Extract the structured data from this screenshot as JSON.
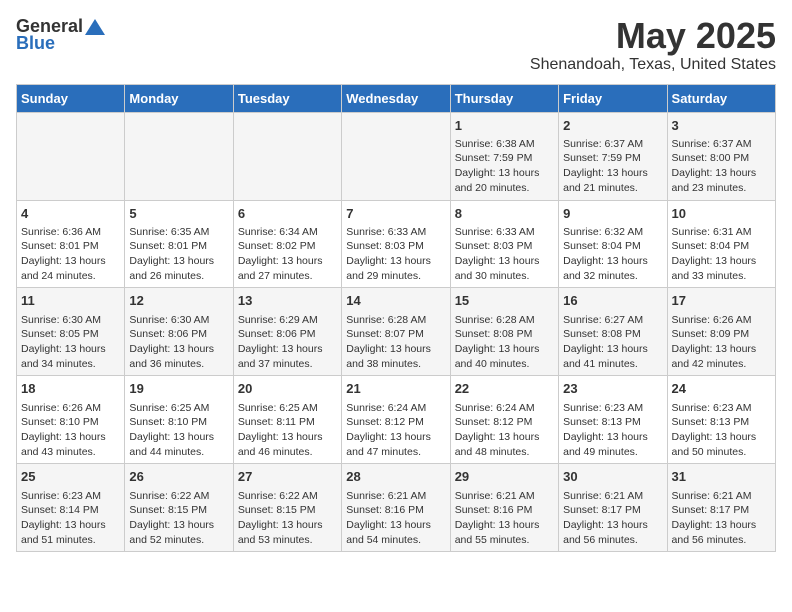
{
  "header": {
    "logo_general": "General",
    "logo_blue": "Blue",
    "title": "May 2025",
    "subtitle": "Shenandoah, Texas, United States"
  },
  "days_of_week": [
    "Sunday",
    "Monday",
    "Tuesday",
    "Wednesday",
    "Thursday",
    "Friday",
    "Saturday"
  ],
  "weeks": [
    [
      {
        "day": "",
        "info": ""
      },
      {
        "day": "",
        "info": ""
      },
      {
        "day": "",
        "info": ""
      },
      {
        "day": "",
        "info": ""
      },
      {
        "day": "1",
        "info": "Sunrise: 6:38 AM\nSunset: 7:59 PM\nDaylight: 13 hours\nand 20 minutes."
      },
      {
        "day": "2",
        "info": "Sunrise: 6:37 AM\nSunset: 7:59 PM\nDaylight: 13 hours\nand 21 minutes."
      },
      {
        "day": "3",
        "info": "Sunrise: 6:37 AM\nSunset: 8:00 PM\nDaylight: 13 hours\nand 23 minutes."
      }
    ],
    [
      {
        "day": "4",
        "info": "Sunrise: 6:36 AM\nSunset: 8:01 PM\nDaylight: 13 hours\nand 24 minutes."
      },
      {
        "day": "5",
        "info": "Sunrise: 6:35 AM\nSunset: 8:01 PM\nDaylight: 13 hours\nand 26 minutes."
      },
      {
        "day": "6",
        "info": "Sunrise: 6:34 AM\nSunset: 8:02 PM\nDaylight: 13 hours\nand 27 minutes."
      },
      {
        "day": "7",
        "info": "Sunrise: 6:33 AM\nSunset: 8:03 PM\nDaylight: 13 hours\nand 29 minutes."
      },
      {
        "day": "8",
        "info": "Sunrise: 6:33 AM\nSunset: 8:03 PM\nDaylight: 13 hours\nand 30 minutes."
      },
      {
        "day": "9",
        "info": "Sunrise: 6:32 AM\nSunset: 8:04 PM\nDaylight: 13 hours\nand 32 minutes."
      },
      {
        "day": "10",
        "info": "Sunrise: 6:31 AM\nSunset: 8:04 PM\nDaylight: 13 hours\nand 33 minutes."
      }
    ],
    [
      {
        "day": "11",
        "info": "Sunrise: 6:30 AM\nSunset: 8:05 PM\nDaylight: 13 hours\nand 34 minutes."
      },
      {
        "day": "12",
        "info": "Sunrise: 6:30 AM\nSunset: 8:06 PM\nDaylight: 13 hours\nand 36 minutes."
      },
      {
        "day": "13",
        "info": "Sunrise: 6:29 AM\nSunset: 8:06 PM\nDaylight: 13 hours\nand 37 minutes."
      },
      {
        "day": "14",
        "info": "Sunrise: 6:28 AM\nSunset: 8:07 PM\nDaylight: 13 hours\nand 38 minutes."
      },
      {
        "day": "15",
        "info": "Sunrise: 6:28 AM\nSunset: 8:08 PM\nDaylight: 13 hours\nand 40 minutes."
      },
      {
        "day": "16",
        "info": "Sunrise: 6:27 AM\nSunset: 8:08 PM\nDaylight: 13 hours\nand 41 minutes."
      },
      {
        "day": "17",
        "info": "Sunrise: 6:26 AM\nSunset: 8:09 PM\nDaylight: 13 hours\nand 42 minutes."
      }
    ],
    [
      {
        "day": "18",
        "info": "Sunrise: 6:26 AM\nSunset: 8:10 PM\nDaylight: 13 hours\nand 43 minutes."
      },
      {
        "day": "19",
        "info": "Sunrise: 6:25 AM\nSunset: 8:10 PM\nDaylight: 13 hours\nand 44 minutes."
      },
      {
        "day": "20",
        "info": "Sunrise: 6:25 AM\nSunset: 8:11 PM\nDaylight: 13 hours\nand 46 minutes."
      },
      {
        "day": "21",
        "info": "Sunrise: 6:24 AM\nSunset: 8:12 PM\nDaylight: 13 hours\nand 47 minutes."
      },
      {
        "day": "22",
        "info": "Sunrise: 6:24 AM\nSunset: 8:12 PM\nDaylight: 13 hours\nand 48 minutes."
      },
      {
        "day": "23",
        "info": "Sunrise: 6:23 AM\nSunset: 8:13 PM\nDaylight: 13 hours\nand 49 minutes."
      },
      {
        "day": "24",
        "info": "Sunrise: 6:23 AM\nSunset: 8:13 PM\nDaylight: 13 hours\nand 50 minutes."
      }
    ],
    [
      {
        "day": "25",
        "info": "Sunrise: 6:23 AM\nSunset: 8:14 PM\nDaylight: 13 hours\nand 51 minutes."
      },
      {
        "day": "26",
        "info": "Sunrise: 6:22 AM\nSunset: 8:15 PM\nDaylight: 13 hours\nand 52 minutes."
      },
      {
        "day": "27",
        "info": "Sunrise: 6:22 AM\nSunset: 8:15 PM\nDaylight: 13 hours\nand 53 minutes."
      },
      {
        "day": "28",
        "info": "Sunrise: 6:21 AM\nSunset: 8:16 PM\nDaylight: 13 hours\nand 54 minutes."
      },
      {
        "day": "29",
        "info": "Sunrise: 6:21 AM\nSunset: 8:16 PM\nDaylight: 13 hours\nand 55 minutes."
      },
      {
        "day": "30",
        "info": "Sunrise: 6:21 AM\nSunset: 8:17 PM\nDaylight: 13 hours\nand 56 minutes."
      },
      {
        "day": "31",
        "info": "Sunrise: 6:21 AM\nSunset: 8:17 PM\nDaylight: 13 hours\nand 56 minutes."
      }
    ]
  ]
}
